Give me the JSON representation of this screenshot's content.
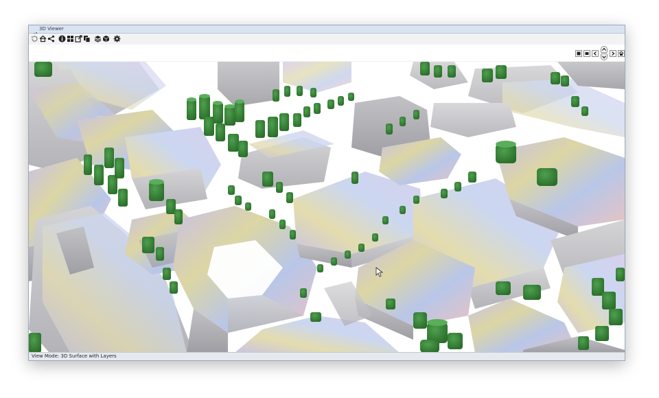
{
  "window": {
    "title": "3D Viewer"
  },
  "toolbar": {
    "buttons": [
      {
        "name": "refresh-icon"
      },
      {
        "name": "home-icon"
      },
      {
        "name": "share-icon"
      },
      {
        "name": "info-icon"
      },
      {
        "name": "grid-icon"
      },
      {
        "name": "export-icon"
      },
      {
        "name": "copy-icon"
      },
      {
        "name": "layers-icon"
      },
      {
        "name": "cube-icon"
      },
      {
        "name": "settings-icon"
      }
    ]
  },
  "navigation": {
    "buttons": [
      {
        "name": "view-box-icon"
      },
      {
        "name": "view-box-alt-icon"
      },
      {
        "name": "pan-left-icon"
      },
      {
        "name": "pan-up-icon"
      },
      {
        "name": "pan-down-icon"
      },
      {
        "name": "pan-right-icon"
      },
      {
        "name": "reset-view-icon"
      }
    ]
  },
  "viewport": {
    "content": "3d-city-model"
  },
  "status": {
    "text": "View Mode: 3D Surface with Layers"
  },
  "colors": {
    "title_bar": "#d9e4f2",
    "window_border": "#9aa7b8",
    "building": "#cfcfd3",
    "tree": "#3a8a3a",
    "tree_dark": "#2a6e2a",
    "ground": "#ffffff"
  }
}
